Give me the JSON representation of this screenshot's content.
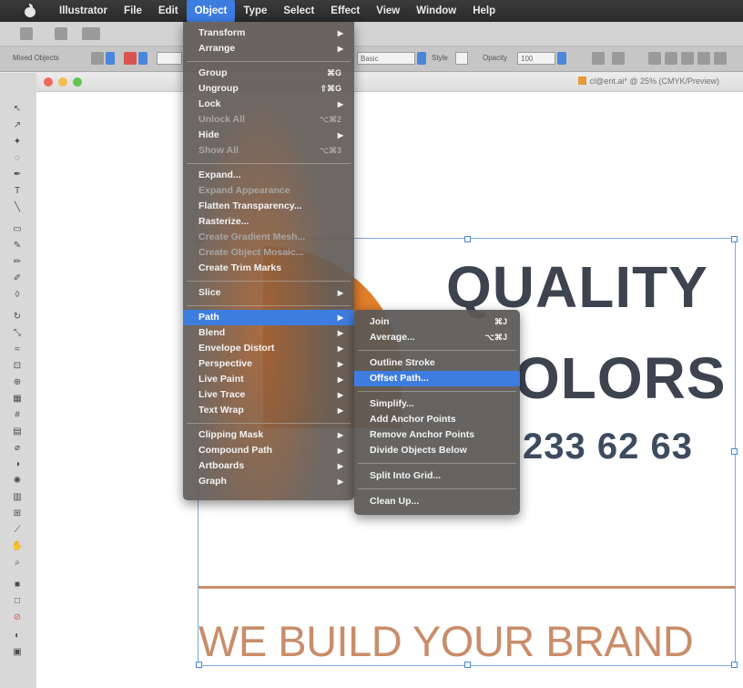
{
  "menubar": {
    "items": [
      "Illustrator",
      "File",
      "Edit",
      "Object",
      "Type",
      "Select",
      "Effect",
      "View",
      "Window",
      "Help"
    ],
    "active_index": 3
  },
  "control_bar": {
    "left_label": "Mixed Objects",
    "stroke_style": "Basic",
    "style_label": "Style",
    "opacity_label": "Opacity",
    "opacity_value": "100"
  },
  "document": {
    "title": "cl@ent.ai* @ 25% (CMYK/Preview)"
  },
  "artwork": {
    "headline_1": "QUALITY",
    "headline_2": "OLORS",
    "phone": "233 62 63",
    "tagline": "WE BUILD YOUR BRAND"
  },
  "object_menu": [
    {
      "label": "Transform",
      "submenu": true
    },
    {
      "label": "Arrange",
      "submenu": true
    },
    {
      "sep": true
    },
    {
      "label": "Group",
      "shortcut": "⌘G"
    },
    {
      "label": "Ungroup",
      "shortcut": "⇧⌘G"
    },
    {
      "label": "Lock",
      "submenu": true
    },
    {
      "label": "Unlock All",
      "shortcut": "⌥⌘2",
      "disabled": true
    },
    {
      "label": "Hide",
      "submenu": true
    },
    {
      "label": "Show All",
      "shortcut": "⌥⌘3",
      "disabled": true
    },
    {
      "sep": true
    },
    {
      "label": "Expand..."
    },
    {
      "label": "Expand Appearance",
      "disabled": true
    },
    {
      "label": "Flatten Transparency..."
    },
    {
      "label": "Rasterize..."
    },
    {
      "label": "Create Gradient Mesh...",
      "disabled": true
    },
    {
      "label": "Create Object Mosaic...",
      "disabled": true
    },
    {
      "label": "Create Trim Marks"
    },
    {
      "sep": true
    },
    {
      "label": "Slice",
      "submenu": true
    },
    {
      "sep": true
    },
    {
      "label": "Path",
      "submenu": true,
      "highlight": true
    },
    {
      "label": "Blend",
      "submenu": true
    },
    {
      "label": "Envelope Distort",
      "submenu": true
    },
    {
      "label": "Perspective",
      "submenu": true
    },
    {
      "label": "Live Paint",
      "submenu": true
    },
    {
      "label": "Live Trace",
      "submenu": true
    },
    {
      "label": "Text Wrap",
      "submenu": true
    },
    {
      "sep": true
    },
    {
      "label": "Clipping Mask",
      "submenu": true
    },
    {
      "label": "Compound Path",
      "submenu": true
    },
    {
      "label": "Artboards",
      "submenu": true
    },
    {
      "label": "Graph",
      "submenu": true
    }
  ],
  "path_submenu": [
    {
      "label": "Join",
      "shortcut": "⌘J"
    },
    {
      "label": "Average...",
      "shortcut": "⌥⌘J"
    },
    {
      "sep": true
    },
    {
      "label": "Outline Stroke"
    },
    {
      "label": "Offset Path...",
      "highlight": true
    },
    {
      "sep": true
    },
    {
      "label": "Simplify..."
    },
    {
      "label": "Add Anchor Points"
    },
    {
      "label": "Remove Anchor Points"
    },
    {
      "label": "Divide Objects Below"
    },
    {
      "sep": true
    },
    {
      "label": "Split Into Grid..."
    },
    {
      "sep": true
    },
    {
      "label": "Clean Up..."
    }
  ],
  "colors": {
    "highlight": "#3d7de0",
    "accent_orange": "#e07e2a",
    "text_dark": "#3d4450",
    "tagline": "#c98d6a"
  }
}
